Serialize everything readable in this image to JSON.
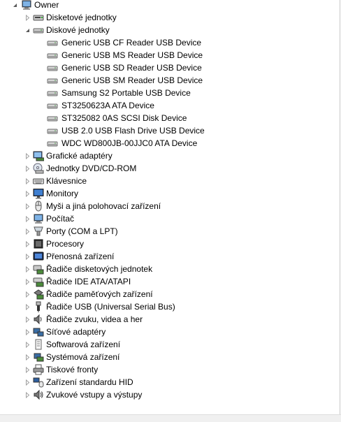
{
  "root": {
    "label": "Owner",
    "icon": "computer-icon",
    "expanded": true
  },
  "categories": [
    {
      "label": "Disketové jednotky",
      "icon": "floppy-drive-icon",
      "expanded": false
    },
    {
      "label": "Diskové jednotky",
      "icon": "disk-drive-icon",
      "expanded": true,
      "children": [
        "Generic USB CF Reader USB Device",
        "Generic USB MS Reader USB Device",
        "Generic USB SD Reader USB Device",
        "Generic USB SM Reader USB Device",
        "Samsung S2 Portable USB Device",
        "ST3250623A ATA Device",
        "ST325082 0AS SCSI Disk Device",
        "USB 2.0 USB Flash Drive USB Device",
        "WDC WD800JB-00JJC0 ATA Device"
      ]
    },
    {
      "label": "Grafické adaptéry",
      "icon": "display-adapter-icon",
      "expanded": false
    },
    {
      "label": "Jednotky DVD/CD-ROM",
      "icon": "dvd-drive-icon",
      "expanded": false
    },
    {
      "label": "Klávesnice",
      "icon": "keyboard-icon",
      "expanded": false
    },
    {
      "label": "Monitory",
      "icon": "monitor-icon",
      "expanded": false
    },
    {
      "label": "Myši a jiná polohovací zařízení",
      "icon": "mouse-icon",
      "expanded": false
    },
    {
      "label": "Počítač",
      "icon": "computer-icon",
      "expanded": false
    },
    {
      "label": "Porty (COM a LPT)",
      "icon": "port-icon",
      "expanded": false
    },
    {
      "label": "Procesory",
      "icon": "processor-icon",
      "expanded": false
    },
    {
      "label": "Přenosná zařízení",
      "icon": "portable-device-icon",
      "expanded": false
    },
    {
      "label": "Řadiče disketových jednotek",
      "icon": "floppy-controller-icon",
      "expanded": false
    },
    {
      "label": "Řadiče IDE ATA/ATAPI",
      "icon": "ide-controller-icon",
      "expanded": false
    },
    {
      "label": "Řadiče paměťových zařízení",
      "icon": "storage-controller-icon",
      "expanded": false
    },
    {
      "label": "Řadiče USB (Universal Serial Bus)",
      "icon": "usb-icon",
      "expanded": false
    },
    {
      "label": "Řadiče zvuku, videa a her",
      "icon": "speaker-icon",
      "expanded": false
    },
    {
      "label": "Síťové adaptéry",
      "icon": "network-adapter-icon",
      "expanded": false
    },
    {
      "label": "Softwarová zařízení",
      "icon": "software-device-icon",
      "expanded": false
    },
    {
      "label": "Systémová zařízení",
      "icon": "system-device-icon",
      "expanded": false
    },
    {
      "label": "Tiskové fronty",
      "icon": "printer-icon",
      "expanded": false
    },
    {
      "label": "Zařízení standardu HID",
      "icon": "hid-icon",
      "expanded": false
    },
    {
      "label": "Zvukové vstupy a výstupy",
      "icon": "audio-io-icon",
      "expanded": false
    }
  ]
}
